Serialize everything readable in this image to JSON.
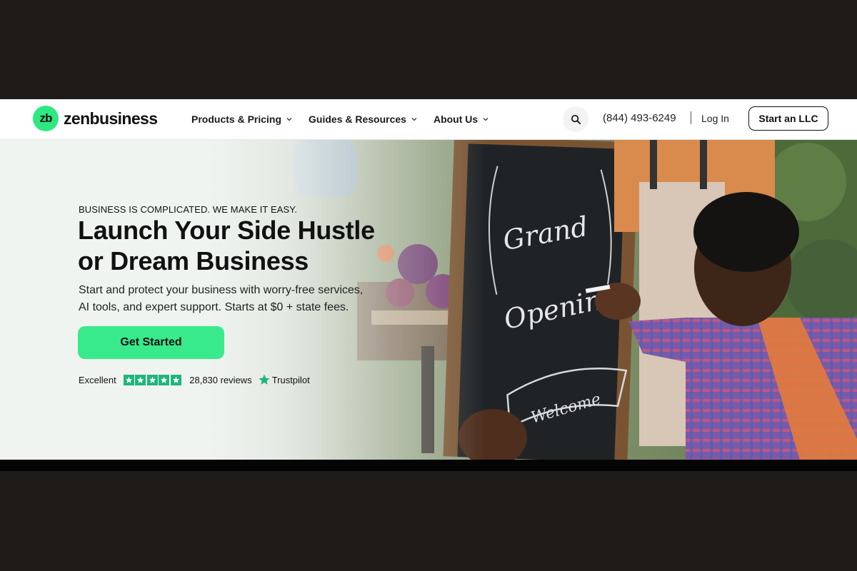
{
  "header": {
    "logo_mark": "zb",
    "logo_text": "zenbusiness",
    "nav": [
      {
        "label": "Products & Pricing"
      },
      {
        "label": "Guides & Resources"
      },
      {
        "label": "About Us"
      }
    ],
    "phone": "(844) 493-6249",
    "divider": "|",
    "login": "Log In",
    "cta": "Start an LLC"
  },
  "hero": {
    "eyebrow": "BUSINESS IS COMPLICATED. WE MAKE IT EASY.",
    "headline_line1": "Launch Your Side Hustle",
    "headline_line2": "or Dream Business",
    "subtext_line1": "Start and protect your business with worry-free services,",
    "subtext_line2": "AI tools, and expert support. Starts at $0 + state fees.",
    "button": "Get Started",
    "rating": {
      "label": "Excellent",
      "stars": 5,
      "reviews": "28,830 reviews",
      "provider": "Trustpilot"
    },
    "chalkboard": {
      "line1": "Grand",
      "line2": "Opening",
      "banner": "Welcome"
    }
  },
  "colors": {
    "accent_green": "#38ea8c",
    "trustpilot_green": "#1fb67a",
    "frame_bg": "#1f1b19"
  },
  "icons": [
    "search-icon",
    "chevron-down-icon",
    "star-icon",
    "trustpilot-star-icon"
  ]
}
